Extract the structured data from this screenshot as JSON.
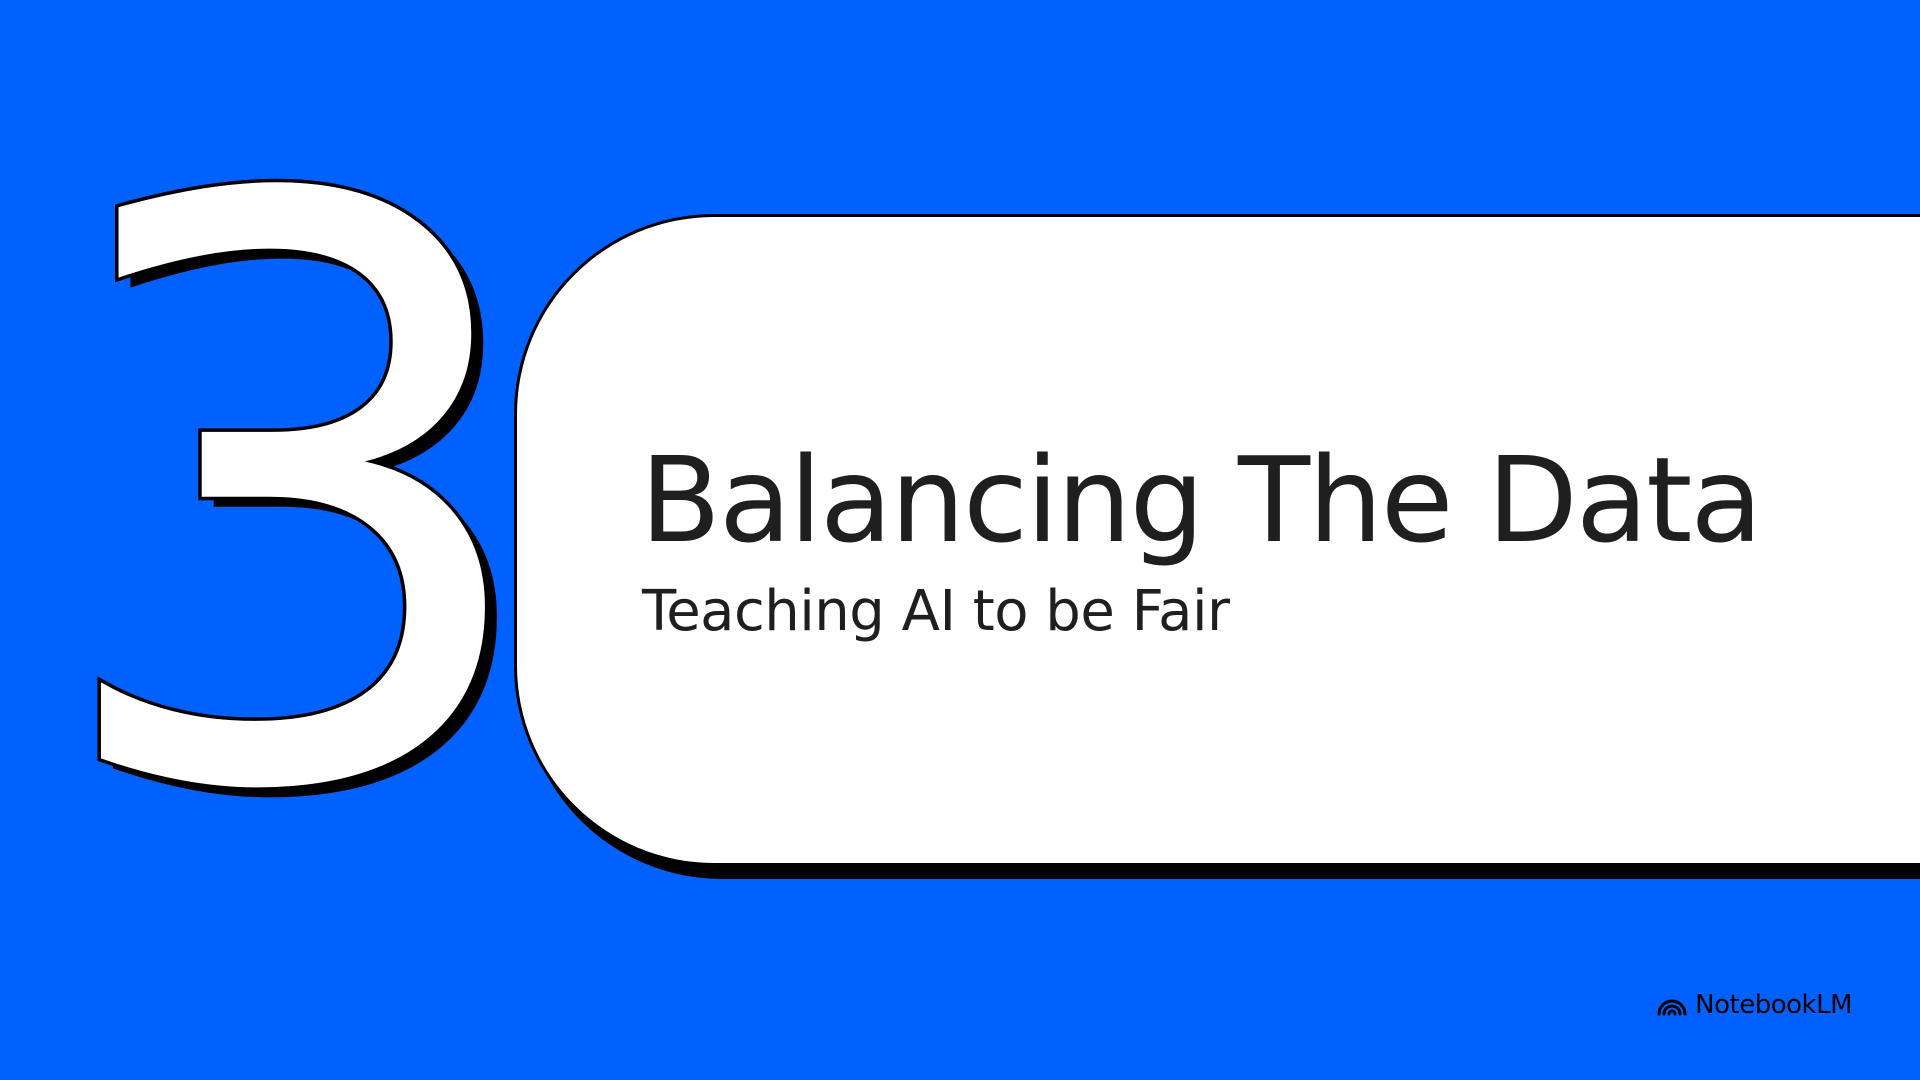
{
  "slide": {
    "section_number": "3",
    "title": "Balancing The Data",
    "subtitle": "Teaching AI to be Fair"
  },
  "branding": {
    "logo_icon": "notebooklm-logo-icon",
    "name": "NotebookLM"
  },
  "colors": {
    "background": "#0061FE",
    "card": "#FFFFFF",
    "outline": "#000000",
    "text": "#1F1F1F"
  }
}
